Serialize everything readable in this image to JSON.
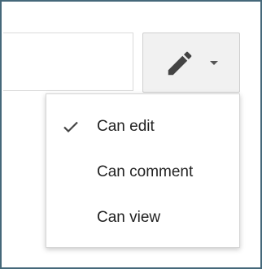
{
  "sharing": {
    "input_value": "",
    "permission_button": {
      "icon": "pencil-icon",
      "dropdown_icon": "caret-down-icon"
    },
    "menu": {
      "items": [
        {
          "label": "Can edit",
          "checked": true
        },
        {
          "label": "Can comment",
          "checked": false
        },
        {
          "label": "Can view",
          "checked": false
        }
      ]
    }
  },
  "colors": {
    "frame_border": "#45687a",
    "button_bg": "#f1f1f1",
    "icon": "#444444"
  }
}
